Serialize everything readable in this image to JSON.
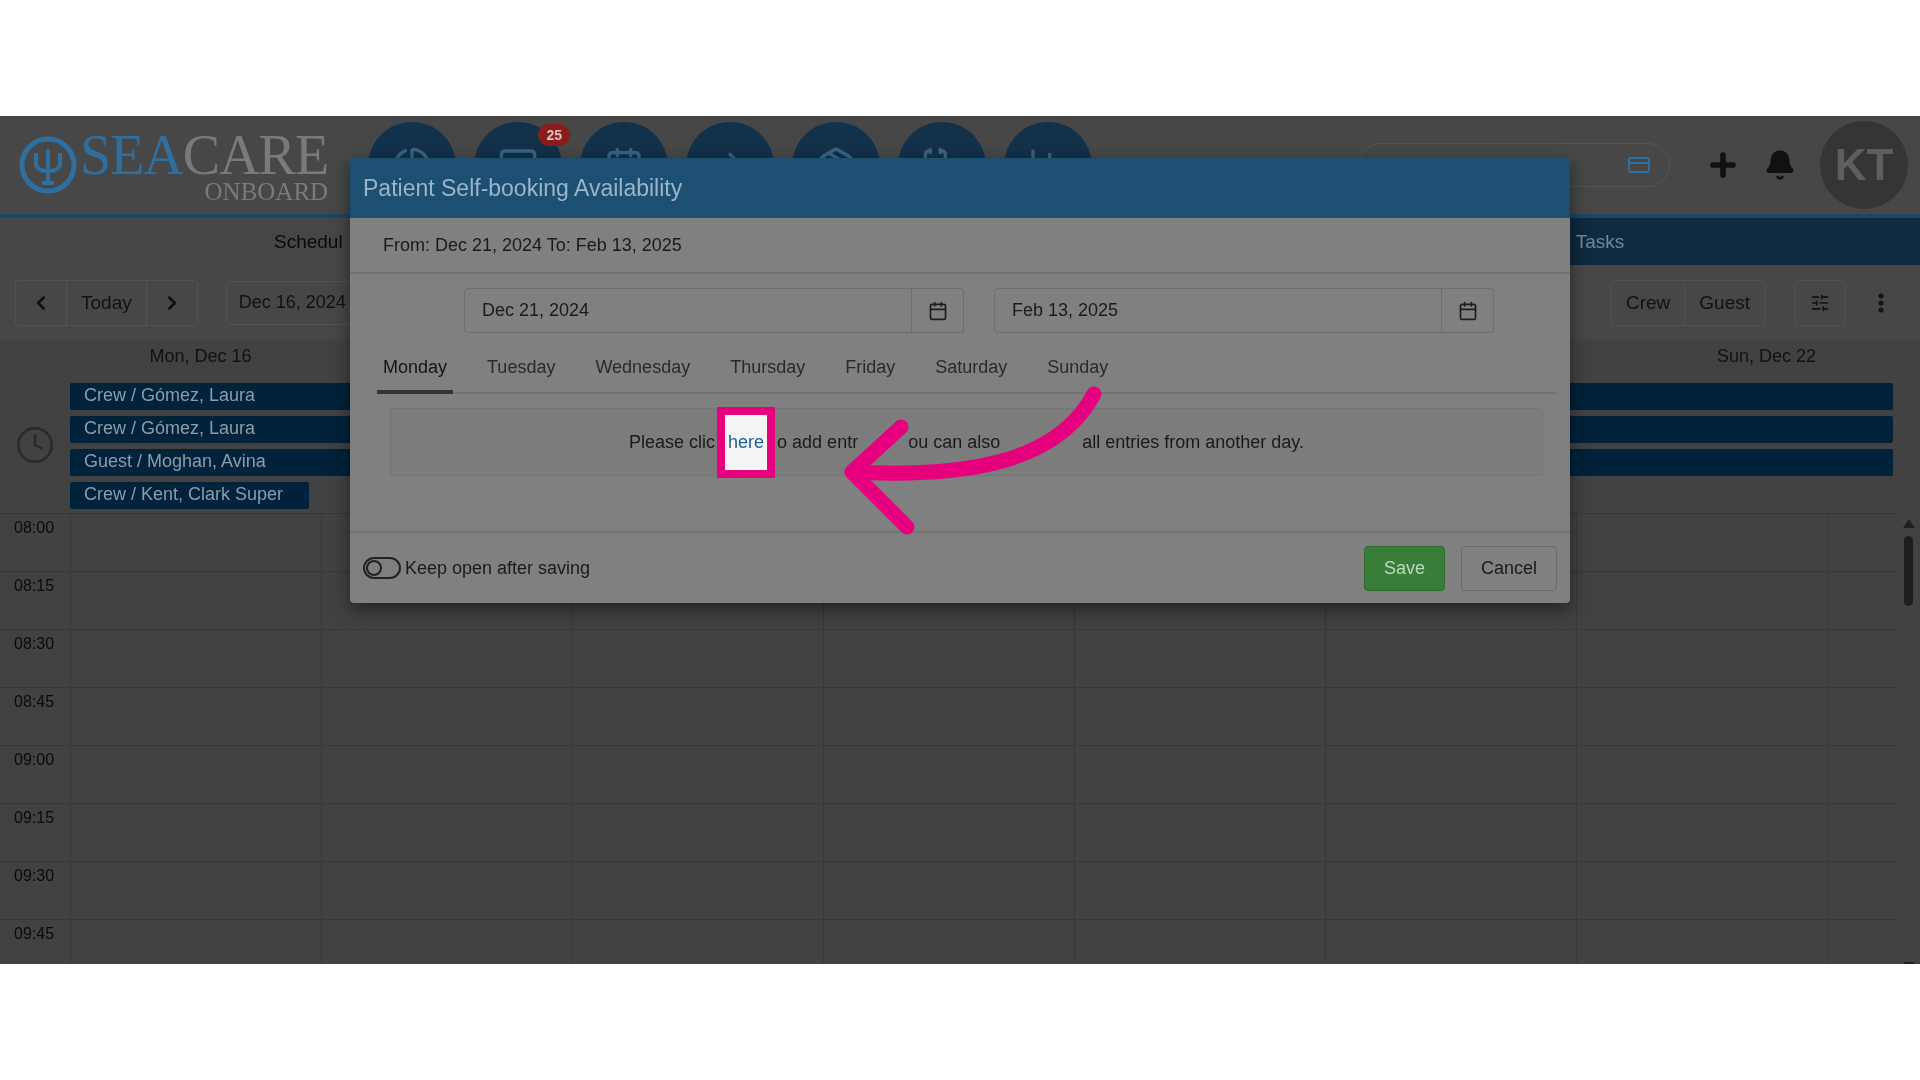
{
  "logo": {
    "primary": "SEA",
    "secondary": "CARE",
    "tagline": "ONBOARD"
  },
  "nav_icons": [
    {
      "kind": "chart"
    },
    {
      "kind": "inbox",
      "badge": "25"
    },
    {
      "kind": "calendar"
    },
    {
      "kind": "arrow"
    },
    {
      "kind": "box"
    },
    {
      "kind": "stethoscope"
    },
    {
      "kind": "bars"
    }
  ],
  "avatar": {
    "initials": "KT"
  },
  "menu": [
    {
      "label": "Schedul",
      "selected": true
    },
    {
      "label": "Tasks",
      "selected": false
    }
  ],
  "toolbar": {
    "today": "Today",
    "date": "Dec 16, 2024",
    "filters": [
      {
        "label": "Crew",
        "selected": false
      },
      {
        "label": "Guest",
        "selected": false
      }
    ]
  },
  "calendar": {
    "day_headers": [
      "Mon, Dec 16",
      "Sun, Dec 22"
    ],
    "events": [
      {
        "label": "Crew / Gómez, Laura",
        "kind": "multi-day"
      },
      {
        "label": "Crew / Gómez, Laura",
        "kind": "multi-day"
      },
      {
        "label": "Guest / Moghan, Avina",
        "kind": "multi-day"
      },
      {
        "label": "Crew / Kent, Clark Super",
        "kind": "single-day"
      }
    ],
    "times": [
      "08:00",
      "08:15",
      "08:30",
      "08:45",
      "09:00",
      "09:15",
      "09:30",
      "09:45"
    ]
  },
  "dialog": {
    "title": "Patient Self-booking Availability",
    "range": "From: Dec 21, 2024 To: Feb 13, 2025",
    "start_date": "Dec 21, 2024",
    "end_date": "Feb 13, 2025",
    "tabs": [
      {
        "label": "Monday",
        "selected": true
      },
      {
        "label": "Tuesday",
        "selected": false
      },
      {
        "label": "Wednesday",
        "selected": false
      },
      {
        "label": "Thursday",
        "selected": false
      },
      {
        "label": "Friday",
        "selected": false
      },
      {
        "label": "Saturday",
        "selected": false
      },
      {
        "label": "Sunday",
        "selected": false
      }
    ],
    "message": [
      {
        "kind": "text",
        "text": "Please clic"
      },
      {
        "kind": "link",
        "text": "here",
        "highlighted": true
      },
      {
        "kind": "text",
        "text": "o add entr"
      },
      {
        "kind": "arrow"
      },
      {
        "kind": "text",
        "text": "ou can also"
      },
      {
        "kind": "text",
        "text": "all entries from another day."
      }
    ],
    "keep_open": {
      "label": "Keep open after saving",
      "on": false
    },
    "buttons": [
      {
        "label": "Save",
        "kind": "primary"
      },
      {
        "label": "Cancel",
        "kind": "default"
      }
    ]
  }
}
